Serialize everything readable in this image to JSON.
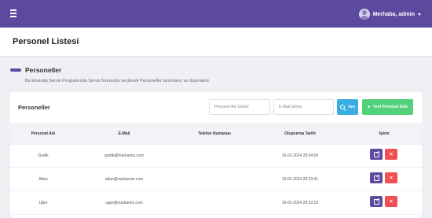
{
  "header": {
    "greeting": "Merhaba, admin"
  },
  "page": {
    "title": "Personel Listesi"
  },
  "section": {
    "title": "Personeller",
    "description": "Bu Ekranda Servis Programında Servis formunda seçilecek Personeller tanımlanır ve düzenlenir."
  },
  "card": {
    "title": "Personeller",
    "name_placeholder": "Personel Adı Giriniz",
    "email_placeholder": "E-Mail Giriniz",
    "search_label": "Ara",
    "add_label": "Yeni Personel Ekle"
  },
  "table": {
    "headers": [
      "Personel Adı",
      "E-Mail",
      "Telefon Numarası",
      "Oluşturma Tarihi",
      "İşlem"
    ],
    "rows": [
      {
        "name": "Grafik",
        "email": "grafik@markamiz.com",
        "phone": "",
        "created": "16-01-2024 20:54:00"
      },
      {
        "name": "Altan",
        "email": "altan@markamiz.com",
        "phone": "",
        "created": "16-01-2024 20:53:41"
      },
      {
        "name": "Uğur",
        "email": "ugur@markamiz.com",
        "phone": "",
        "created": "16-01-2024 20:53:23"
      }
    ]
  },
  "colors": {
    "primary": "#5c4a9e",
    "info": "#3aaee2",
    "success": "#52d17a",
    "danger": "#f05052"
  },
  "icons": {
    "menu": "hamburger-icon",
    "user": "user-avatar-icon",
    "search": "search-icon",
    "add": "plus-icon",
    "edit": "edit-icon",
    "delete": "close-icon"
  }
}
